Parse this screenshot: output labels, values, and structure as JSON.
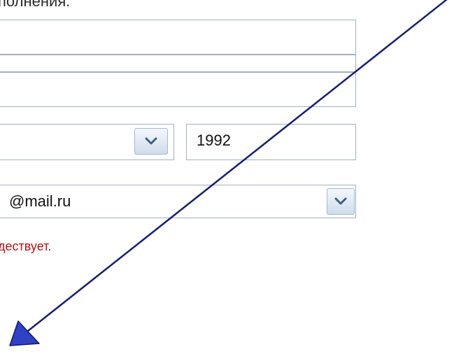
{
  "form": {
    "heading": "полнения.",
    "year_value": "1992",
    "email_domain": "@mail.ru",
    "error_message": "дествует."
  },
  "icons": {
    "dropdown": "chevron-down-icon",
    "pointer": "arrow-annotation-icon"
  },
  "colors": {
    "field_border": "#9fb0c0",
    "error": "#b0141b",
    "arrow": "#2b3ea8"
  }
}
